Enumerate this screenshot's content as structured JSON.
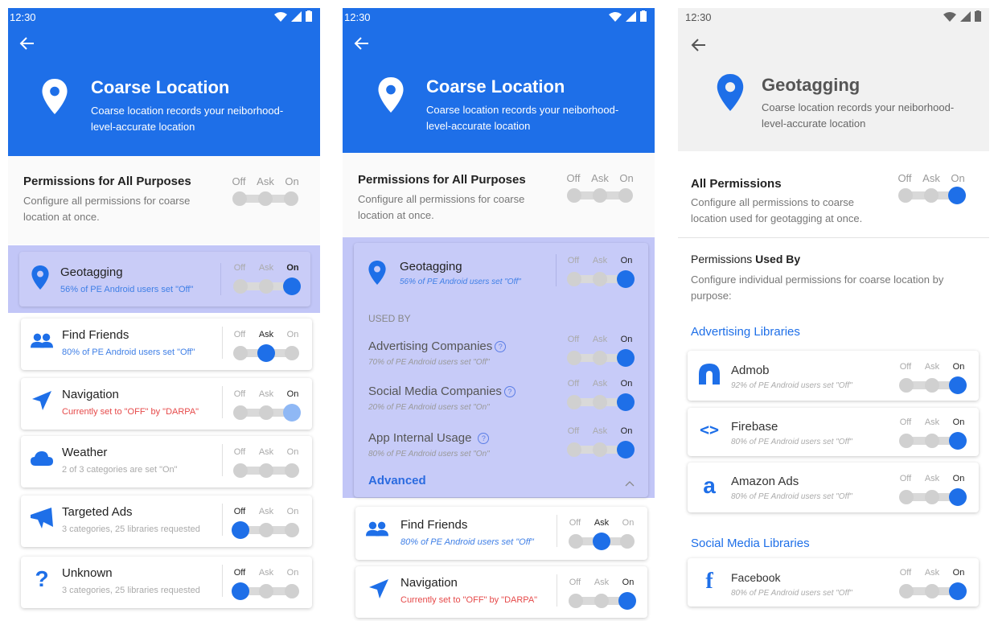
{
  "status": {
    "time": "12:30"
  },
  "colors": {
    "primary": "#1e6fe8",
    "highlight": "#c2c6f7",
    "warning": "#e64a4a"
  },
  "toggle_labels": {
    "off": "Off",
    "ask": "Ask",
    "on": "On"
  },
  "screen1": {
    "header": {
      "title": "Coarse Location",
      "description": "Coarse location records your neiborhood-level-accurate location"
    },
    "all": {
      "title": "Permissions for All Purposes",
      "description": "Configure all permissions for coarse location at once."
    },
    "items": [
      {
        "title": "Geotagging",
        "subtitle": "56% of PE Android users set \"Off\"",
        "icon": "location-pin-icon",
        "state": "On"
      },
      {
        "title": "Find Friends",
        "subtitle": "80% of PE Android users set \"Off\"",
        "icon": "people-icon",
        "state": "Ask"
      },
      {
        "title": "Navigation",
        "subtitle": "Currently set to \"OFF\" by \"DARPA\"",
        "icon": "navigation-arrow-icon",
        "state": "On"
      },
      {
        "title": "Weather",
        "subtitle": "2 of 3 categories are set \"On\"",
        "icon": "cloud-icon",
        "state": "None"
      },
      {
        "title": "Targeted Ads",
        "subtitle": "3 categories, 25 libraries requested",
        "icon": "megaphone-icon",
        "state": "Off"
      },
      {
        "title": "Unknown",
        "subtitle": "3 categories, 25 libraries requested",
        "icon": "question-icon",
        "state": "Off"
      }
    ]
  },
  "screen2": {
    "header": {
      "title": "Coarse Location",
      "description": "Coarse location records your neiborhood-level-accurate location"
    },
    "all": {
      "title": "Permissions for All Purposes",
      "description": "Configure all permissions for coarse location at once."
    },
    "geotagging": {
      "title": "Geotagging",
      "subtitle": "56% of PE Android users set \"Off\""
    },
    "used_by_label": "USED BY",
    "used_by": [
      {
        "title": "Advertising Companies",
        "subtitle": "70% of PE Android users set \"Off\"",
        "state": "On"
      },
      {
        "title": "Social Media Companies",
        "subtitle": "20% of PE Android users set \"On\"",
        "state": "On"
      },
      {
        "title": "App Internal Usage",
        "subtitle": "80% of PE Android users set \"On\"",
        "state": "On"
      }
    ],
    "advanced_label": "Advanced",
    "help_glyph": "?",
    "items": [
      {
        "title": "Find Friends",
        "subtitle": "80% of PE Android users set \"Off\"",
        "state": "Ask"
      },
      {
        "title": "Navigation",
        "subtitle": "Currently set to \"OFF\" by \"DARPA\"",
        "state": "On"
      }
    ]
  },
  "screen3": {
    "header": {
      "title": "Geotagging",
      "description": "Coarse location records your neiborhood-level-accurate location"
    },
    "all": {
      "title": "All Permissions",
      "description": "Configure all permissions to coarse location used for geotagging at once."
    },
    "used_by": {
      "title_prefix": "Permissions ",
      "title_bold": "Used By",
      "description": "Configure individual permissions for coarse location by purpose:"
    },
    "sections": [
      {
        "title": "Advertising Libraries",
        "items": [
          {
            "title": "Admob",
            "subtitle": "92% of PE Android users set \"Off\"",
            "icon": "admob-icon",
            "state": "On"
          },
          {
            "title": "Firebase",
            "subtitle": "80% of PE Android users set \"Off\"",
            "icon": "code-brackets-icon",
            "state": "On"
          },
          {
            "title": "Amazon Ads",
            "subtitle": "80% of PE Android users set \"Off\"",
            "icon": "amazon-icon",
            "state": "On"
          }
        ]
      },
      {
        "title": "Social Media Libraries",
        "items": [
          {
            "title": "Facebook",
            "subtitle": "80% of PE Android users set \"Off\"",
            "icon": "facebook-icon",
            "state": "On"
          }
        ]
      }
    ]
  }
}
